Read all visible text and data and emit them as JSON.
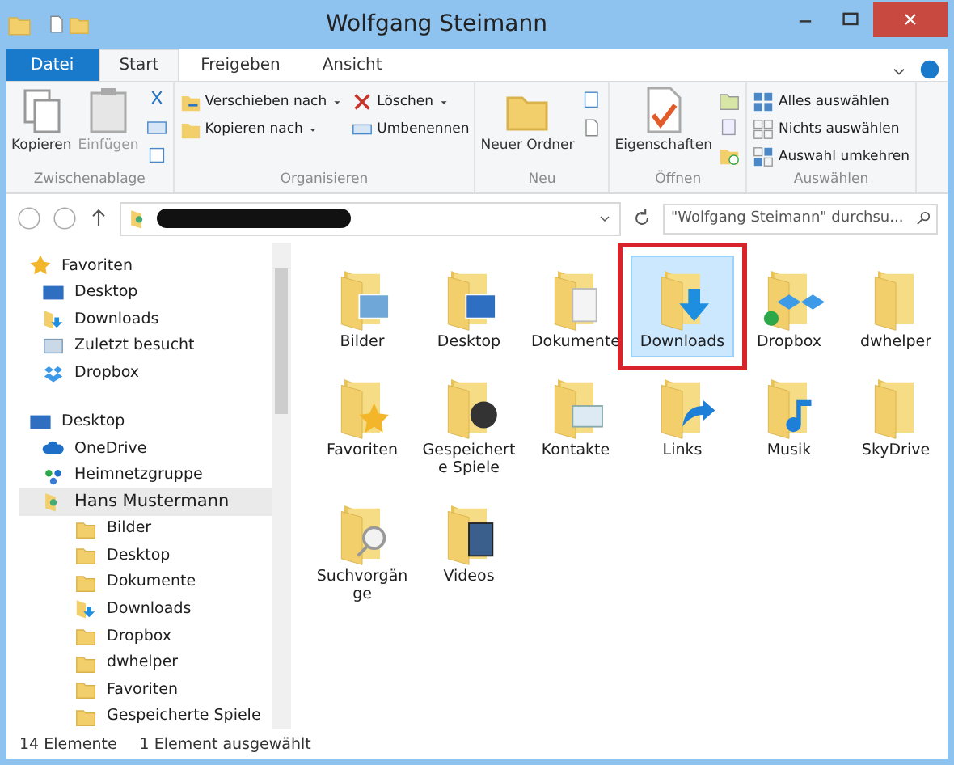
{
  "window": {
    "title": "Wolfgang Steimann"
  },
  "tabs": [
    {
      "label": "Datei",
      "kind": "file",
      "selected": false
    },
    {
      "label": "Start",
      "kind": "tab",
      "selected": true
    },
    {
      "label": "Freigeben",
      "kind": "tab",
      "selected": false
    },
    {
      "label": "Ansicht",
      "kind": "tab",
      "selected": false
    }
  ],
  "ribbon": [
    {
      "label": "Zwischenablage",
      "items": [
        {
          "label": "Kopieren",
          "kind": "large",
          "disabled": false
        },
        {
          "label": "Einfügen",
          "kind": "large",
          "disabled": true
        },
        {
          "kind": "stack"
        }
      ]
    },
    {
      "label": "Organisieren",
      "items": [
        {
          "kind": "column",
          "rows": [
            {
              "label": "Verschieben nach",
              "dropdown": true
            },
            {
              "label": "Kopieren nach",
              "dropdown": true
            }
          ]
        },
        {
          "kind": "column",
          "rows": [
            {
              "label": "Löschen",
              "dropdown": true
            },
            {
              "label": "Umbenennen",
              "dropdown": false
            }
          ]
        }
      ]
    },
    {
      "label": "Neu",
      "items": [
        {
          "label": "Neuer Ordner",
          "kind": "large",
          "disabled": false
        },
        {
          "kind": "stack"
        }
      ]
    },
    {
      "label": "Öffnen",
      "items": [
        {
          "label": "Eigenschaften",
          "kind": "large",
          "disabled": false
        },
        {
          "kind": "stack"
        }
      ]
    },
    {
      "label": "Auswählen",
      "items": [
        {
          "kind": "column",
          "rows": [
            {
              "label": "Alles auswählen",
              "dropdown": false
            },
            {
              "label": "Nichts auswählen",
              "dropdown": false
            },
            {
              "label": "Auswahl umkehren",
              "dropdown": false
            }
          ]
        }
      ]
    }
  ],
  "search": {
    "placeholder": "\"Wolfgang Steimann\" durchsu..."
  },
  "navigation": [
    {
      "label": "Favoriten",
      "kind": "star",
      "selected": false,
      "children": [
        {
          "label": "Desktop",
          "kind": "desktop",
          "selected": false
        },
        {
          "label": "Downloads",
          "kind": "downloads",
          "selected": false
        },
        {
          "label": "Zuletzt besucht",
          "kind": "recent",
          "selected": false
        },
        {
          "label": "Dropbox",
          "kind": "dropbox",
          "selected": false
        }
      ]
    },
    {
      "label": "Desktop",
      "kind": "desktop",
      "selected": false,
      "children": [
        {
          "label": "OneDrive",
          "kind": "cloud",
          "selected": false
        },
        {
          "label": "Heimnetzgruppe",
          "kind": "network",
          "selected": false
        },
        {
          "label": "Hans Mustermann",
          "kind": "user",
          "selected": true,
          "children": [
            {
              "label": "Bilder",
              "kind": "folder",
              "selected": false
            },
            {
              "label": "Desktop",
              "kind": "folder",
              "selected": false
            },
            {
              "label": "Dokumente",
              "kind": "folder",
              "selected": false
            },
            {
              "label": "Downloads",
              "kind": "downloads",
              "selected": false
            },
            {
              "label": "Dropbox",
              "kind": "folder",
              "selected": false
            },
            {
              "label": "dwhelper",
              "kind": "folder",
              "selected": false
            },
            {
              "label": "Favoriten",
              "kind": "folder",
              "selected": false
            },
            {
              "label": "Gespeicherte Spiele",
              "kind": "folder",
              "selected": false
            }
          ]
        }
      ]
    }
  ],
  "files": [
    {
      "label": "Bilder",
      "kind": "pictures",
      "selected": false,
      "marked": false
    },
    {
      "label": "Desktop",
      "kind": "desktop",
      "selected": false,
      "marked": false
    },
    {
      "label": "Dokumente",
      "kind": "documents",
      "selected": false,
      "marked": false
    },
    {
      "label": "Downloads",
      "kind": "downloads",
      "selected": true,
      "marked": true
    },
    {
      "label": "Dropbox",
      "kind": "dropbox",
      "selected": false,
      "marked": false
    },
    {
      "label": "dwhelper",
      "kind": "plain",
      "selected": false,
      "marked": false
    },
    {
      "label": "Favoriten",
      "kind": "favorites",
      "selected": false,
      "marked": false
    },
    {
      "label": "Gespeicherte Spiele",
      "kind": "games",
      "selected": false,
      "marked": false
    },
    {
      "label": "Kontakte",
      "kind": "contacts",
      "selected": false,
      "marked": false
    },
    {
      "label": "Links",
      "kind": "links",
      "selected": false,
      "marked": false
    },
    {
      "label": "Musik",
      "kind": "music",
      "selected": false,
      "marked": false
    },
    {
      "label": "SkyDrive",
      "kind": "plain",
      "selected": false,
      "marked": false
    },
    {
      "label": "Suchvorgänge",
      "kind": "search",
      "selected": false,
      "marked": false
    },
    {
      "label": "Videos",
      "kind": "videos",
      "selected": false,
      "marked": false
    }
  ],
  "status_bar": {
    "count": "14 Elemente",
    "selection": "1 Element ausgewählt"
  }
}
